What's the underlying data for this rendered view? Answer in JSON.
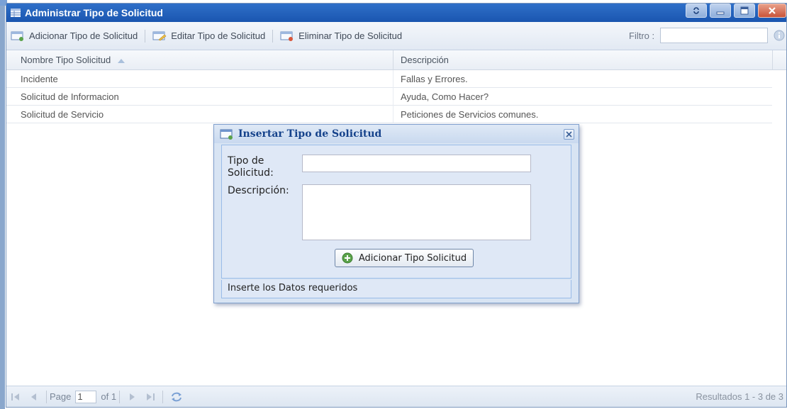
{
  "window": {
    "title": "Administrar Tipo de Solicitud"
  },
  "toolbar": {
    "add_label": "Adicionar Tipo de Solicitud",
    "edit_label": "Editar Tipo de Solicitud",
    "delete_label": "Eliminar Tipo de Solicitud",
    "filter_label": "Filtro :",
    "filter_value": ""
  },
  "grid": {
    "columns": [
      "Nombre Tipo Solicitud",
      "Descripción"
    ],
    "rows": [
      {
        "name": "Incidente",
        "description": "Fallas y Errores."
      },
      {
        "name": "Solicitud de Informacion",
        "description": "Ayuda, Como Hacer?"
      },
      {
        "name": "Solicitud de Servicio",
        "description": "Peticiones de Servicios comunes."
      }
    ]
  },
  "paging": {
    "page_label": "Page",
    "page_value": "1",
    "of_label": "of 1",
    "results": "Resultados 1 - 3 de 3"
  },
  "dialog": {
    "title": "Insertar Tipo de Solicitud",
    "tipo_label": "Tipo de Solicitud:",
    "tipo_value": "",
    "desc_label": "Descripción:",
    "desc_value": "",
    "add_button": "Adicionar Tipo Solicitud",
    "status": "Inserte los Datos requeridos"
  },
  "colors": {
    "titlebar": "#1f5fb8",
    "dialog_title": "#15428b",
    "dialog_bg": "#dfe8f6",
    "add_icon_green": "#5aa24a"
  },
  "icons": {
    "grid": "grid-icon",
    "add": "add-document-icon",
    "edit": "edit-document-icon",
    "delete": "delete-document-icon",
    "info": "info-icon",
    "refresh": "refresh-icon",
    "plus": "green-plus-icon"
  }
}
